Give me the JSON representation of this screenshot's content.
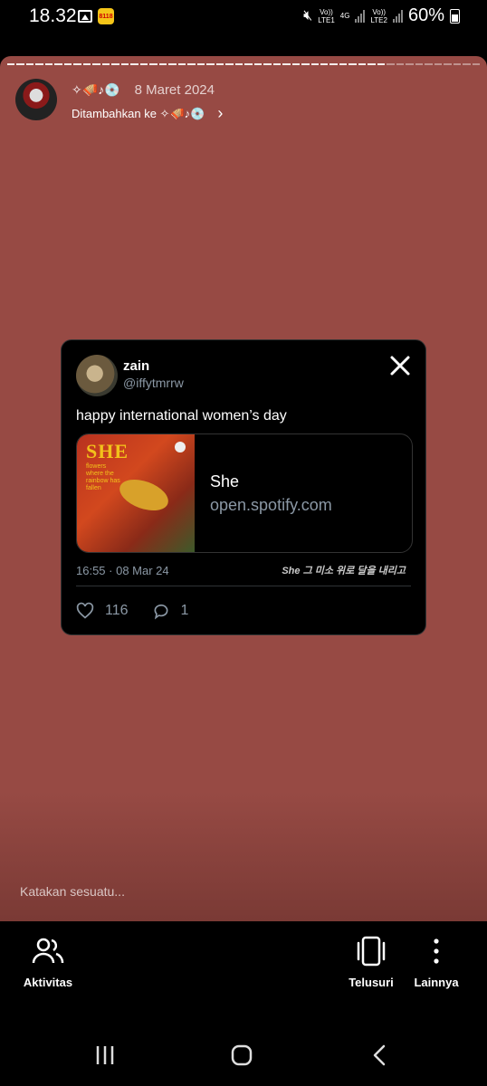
{
  "status_bar": {
    "time": "18.32",
    "app_badge": "8118",
    "lte1": "Vo))\nLTE1",
    "net": "4G",
    "lte2": "Vo))\nLTE2",
    "battery": "60%"
  },
  "story": {
    "emoji_title": "✧🪗♪💿",
    "date": "8 Maret 2024",
    "added_to": "Ditambahkan ke ✧🪗♪💿",
    "reply_placeholder": "Katakan sesuatu..."
  },
  "tweet": {
    "name": "zain",
    "handle": "@iffytmrrw",
    "text": "happy international women’s day",
    "album_title": "SHE",
    "album_subtitle": "flowers where the rainbow has fallen",
    "link_title": "She",
    "link_domain": "open.spotify.com",
    "meta": "16:55 · 08 Mar 24",
    "caption": "She 그 미소 위로 달을 내리고",
    "likes": "116",
    "replies": "1"
  },
  "bottom_actions": {
    "activity": "Aktivitas",
    "browse": "Telusuri",
    "more": "Lainnya"
  },
  "icons": {
    "like": "heart-icon",
    "reply": "reply-icon",
    "close": "x-logo-icon"
  }
}
